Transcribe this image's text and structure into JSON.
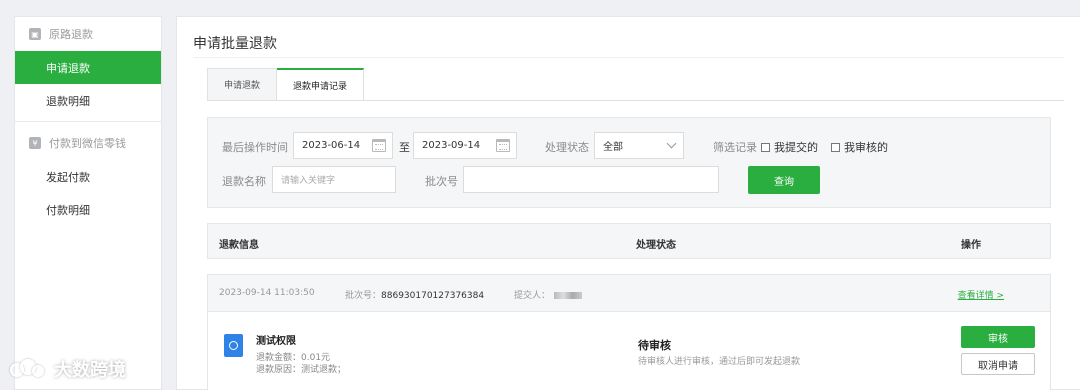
{
  "sidebar": {
    "group1": "原路退款",
    "items1": [
      "申请退款",
      "退款明细"
    ],
    "group2": "付款到微信零钱",
    "items2": [
      "发起付款",
      "付款明细"
    ]
  },
  "page": {
    "title": "申请批量退款"
  },
  "tabs": [
    "申请退款",
    "退款申请记录"
  ],
  "filter": {
    "last_op_label": "最后操作时间",
    "date_from": "2023-06-14",
    "to": "至",
    "date_to": "2023-09-14",
    "status_label": "处理状态",
    "status_value": "全部",
    "filter_label": "筛选记录",
    "mine_submitted": "我提交的",
    "mine_reviewed": "我审核的",
    "name_label": "退款名称",
    "name_placeholder": "请输入关键字",
    "batch_label": "批次号",
    "batch_value": "",
    "query_button": "查询"
  },
  "table": {
    "headers": [
      "退款信息",
      "处理状态",
      "操作"
    ],
    "rows": [
      {
        "time": "2023-09-14 11:03:50",
        "batch_label": "批次号：",
        "batch_no": "886930170127376384",
        "submitter_label": "提交人：",
        "details_link": "查看详情 >",
        "name": "测试权限",
        "amount": "退款金额：0.01元",
        "reason": "退款原因：测试退款；",
        "status": "待审核",
        "status_desc": "待审核人进行审核，通过后即可发起退款",
        "approve_button": "审核",
        "cancel_button": "取消申请"
      }
    ]
  },
  "watermark": "大数跨境",
  "colors": {
    "accent": "#2aae40",
    "icon_blue": "#2f83e6"
  }
}
